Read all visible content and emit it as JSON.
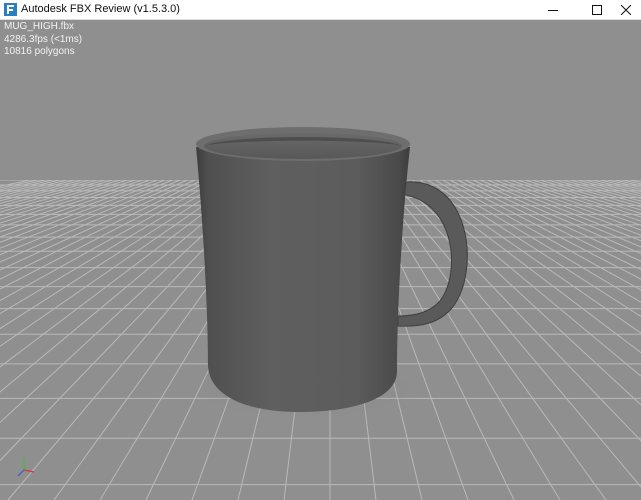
{
  "window": {
    "title": "Autodesk FBX Review (v1.5.3.0)",
    "app_icon": "fbx-review-app-icon",
    "controls": [
      "minimize-icon",
      "maximize-icon",
      "close-icon"
    ]
  },
  "viewport": {
    "background_color": "#8f8f8f",
    "grid_color": "#b9b9b9",
    "model_color": "#5c5c5c",
    "hud": {
      "file_name": "MUG_HIGH.fbx",
      "fps": "4286.3fps (<1ms)",
      "polygons": "10816 polygons"
    },
    "axis_gizmo": {
      "x_color": "#d23a3a",
      "y_color": "#3ac23a",
      "z_color": "#3a5ad2"
    }
  }
}
